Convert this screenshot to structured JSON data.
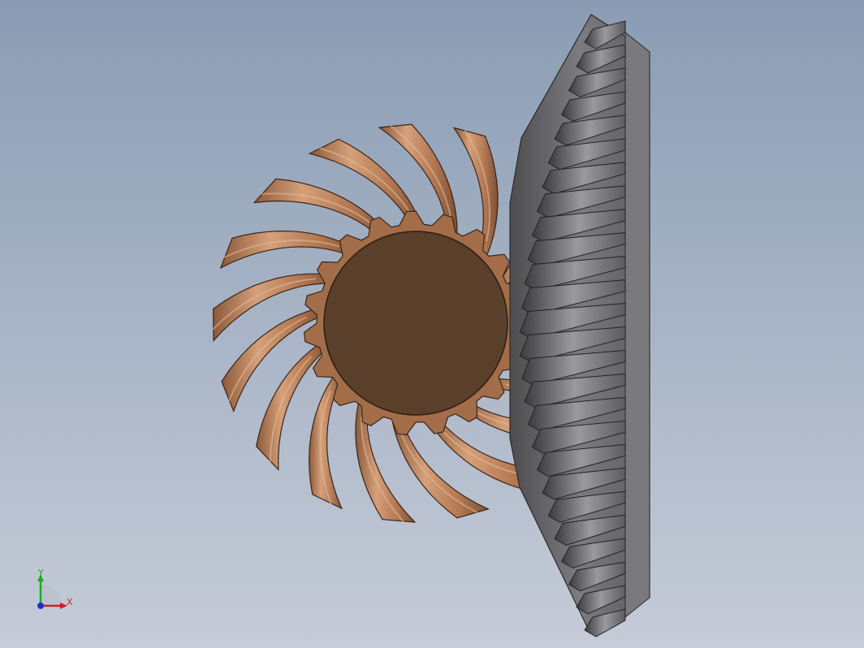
{
  "viewport": {
    "background_top": "#8a9cb4",
    "background_bottom": "#c6ccd8"
  },
  "pinion": {
    "color": "#b57b55",
    "bore_color": "#5a3f2b"
  },
  "ring_gear": {
    "color": "#6f6f72"
  },
  "triad": {
    "x_label": "X",
    "y_label": "Y",
    "x_color": "#d22020",
    "y_color": "#1faa2a",
    "z_color": "#1a2fd0"
  }
}
